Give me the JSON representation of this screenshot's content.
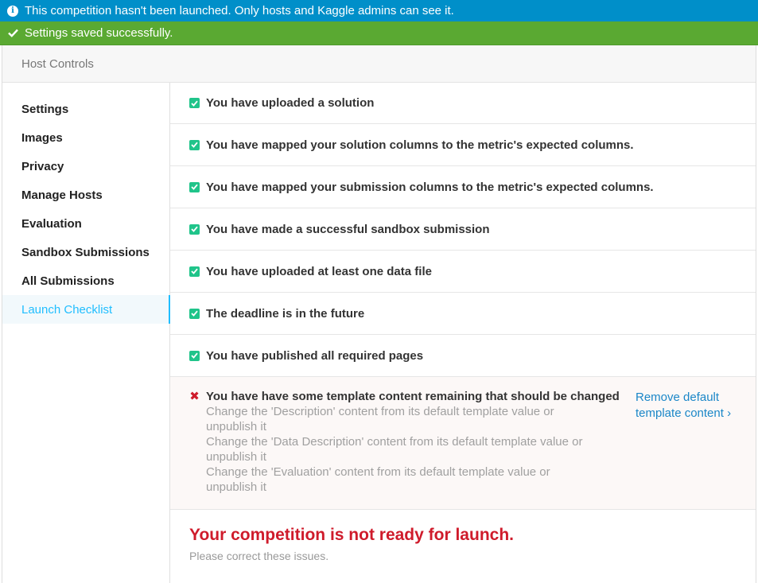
{
  "banners": {
    "info": "This competition hasn't been launched. Only hosts and Kaggle admins can see it.",
    "success": "Settings saved successfully."
  },
  "header": {
    "title": "Host Controls"
  },
  "sidebar": {
    "items": [
      {
        "label": "Settings"
      },
      {
        "label": "Images"
      },
      {
        "label": "Privacy"
      },
      {
        "label": "Manage Hosts"
      },
      {
        "label": "Evaluation"
      },
      {
        "label": "Sandbox Submissions"
      },
      {
        "label": "All Submissions"
      },
      {
        "label": "Launch Checklist",
        "active": true
      }
    ]
  },
  "checklist": {
    "passed": [
      {
        "text": "You have uploaded a solution"
      },
      {
        "text": "You have mapped your solution columns to the metric's expected columns."
      },
      {
        "text": "You have mapped your submission columns to the metric's expected columns."
      },
      {
        "text": "You have made a successful sandbox submission"
      },
      {
        "text": "You have uploaded at least one data file"
      },
      {
        "text": "The deadline is in the future"
      },
      {
        "text": "You have published all required pages"
      }
    ],
    "failed": {
      "title": "You have have some template content remaining that should be changed",
      "details": [
        "Change the 'Description' content from its default template value or unpublish it",
        "Change the 'Data Description' content from its default template value or unpublish it",
        "Change the 'Evaluation' content from its default template value or unpublish it"
      ],
      "action": "Remove default template content ›"
    }
  },
  "result": {
    "title": "Your competition is not ready for launch.",
    "subtitle": "Please correct these issues."
  },
  "colors": {
    "info_banner": "#008fc9",
    "success_banner": "#5aa932",
    "check_green": "#20c48a",
    "error_red": "#cf1b2b",
    "active_blue": "#20beff",
    "link_blue": "#1b87c8"
  },
  "icons": {
    "info": "info-circle-icon",
    "success": "checkmark-icon",
    "passed": "checkbox-checked-icon",
    "failed": "x-icon"
  }
}
